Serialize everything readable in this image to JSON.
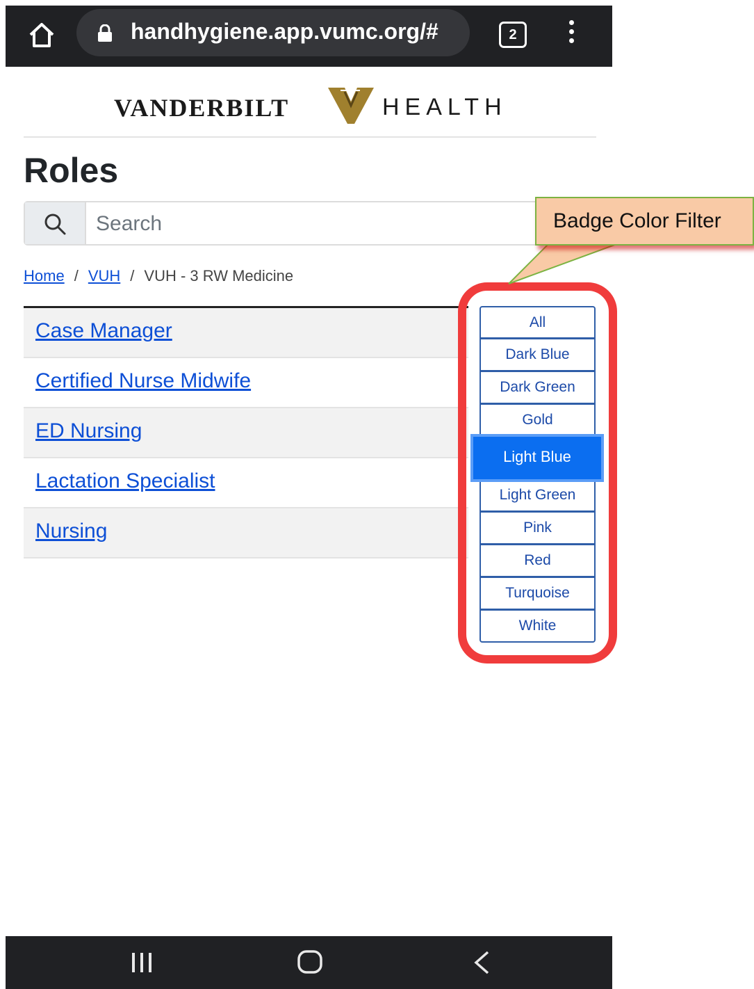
{
  "browser": {
    "url": "handhygiene.app.vumc.org/#",
    "tab_count": "2"
  },
  "logo": {
    "left_text": "VANDERBILT",
    "right_text": "HEALTH",
    "colors": {
      "gold": "#a0802e",
      "dark": "#1a1a1a"
    }
  },
  "page": {
    "title": "Roles",
    "search_placeholder": "Search"
  },
  "breadcrumb": {
    "home": "Home",
    "sep1": "/",
    "vuh": "VUH",
    "sep2": "/",
    "current": "VUH - 3 RW Medicine"
  },
  "roles": [
    {
      "label": "Case Manager"
    },
    {
      "label": "Certified Nurse Midwife"
    },
    {
      "label": "ED Nursing"
    },
    {
      "label": "Lactation Specialist"
    },
    {
      "label": "Nursing"
    }
  ],
  "filters": {
    "selected": "Light Blue",
    "items": [
      {
        "label": "All"
      },
      {
        "label": "Dark Blue"
      },
      {
        "label": "Dark Green"
      },
      {
        "label": "Gold"
      },
      {
        "label": "Light Blue"
      },
      {
        "label": "Light Green"
      },
      {
        "label": "Pink"
      },
      {
        "label": "Red"
      },
      {
        "label": "Turquoise"
      },
      {
        "label": "White"
      }
    ]
  },
  "callout": {
    "text": "Badge Color Filter"
  },
  "colors": {
    "link": "#0d4fd6",
    "accent": "#0b6ef0",
    "highlight_ring": "#f03c3c",
    "callout_fill": "#f9caa6"
  }
}
